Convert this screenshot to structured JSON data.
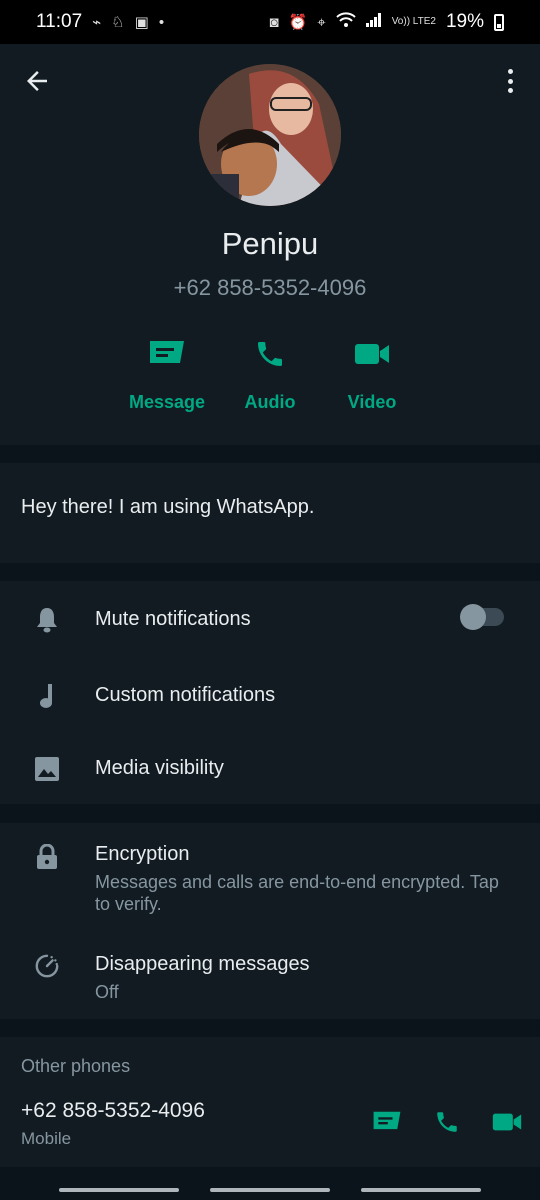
{
  "status_bar": {
    "time": "11:07",
    "left_icons": [
      "pulse-icon",
      "run-icon",
      "app-icon",
      "dot-icon"
    ],
    "right_icons": [
      "camera-icon",
      "alarm-icon",
      "location-icon",
      "wifi-icon",
      "signal-icon"
    ],
    "network": "Vo)) LTE2",
    "battery": "19%"
  },
  "header": {
    "contact_name": "Penipu",
    "phone_number": "+62 858-5352-4096",
    "actions": [
      {
        "label": "Message",
        "icon": "message-icon"
      },
      {
        "label": "Audio",
        "icon": "phone-icon"
      },
      {
        "label": "Video",
        "icon": "video-icon"
      }
    ]
  },
  "about": {
    "text": "Hey there! I am using WhatsApp."
  },
  "settings": {
    "mute": {
      "label": "Mute notifications",
      "enabled": false
    },
    "custom": {
      "label": "Custom notifications"
    },
    "media": {
      "label": "Media visibility"
    }
  },
  "security": {
    "encryption": {
      "title": "Encryption",
      "subtitle": "Messages and calls are end-to-end encrypted. Tap to verify."
    },
    "disappearing": {
      "title": "Disappearing messages",
      "subtitle": "Off"
    }
  },
  "other_phones": {
    "label": "Other phones",
    "number": "+62 858-5352-4096",
    "type": "Mobile"
  },
  "colors": {
    "accent": "#00a884",
    "background": "#0b141a",
    "panel": "#111b21",
    "secondary_text": "#8696a0"
  }
}
